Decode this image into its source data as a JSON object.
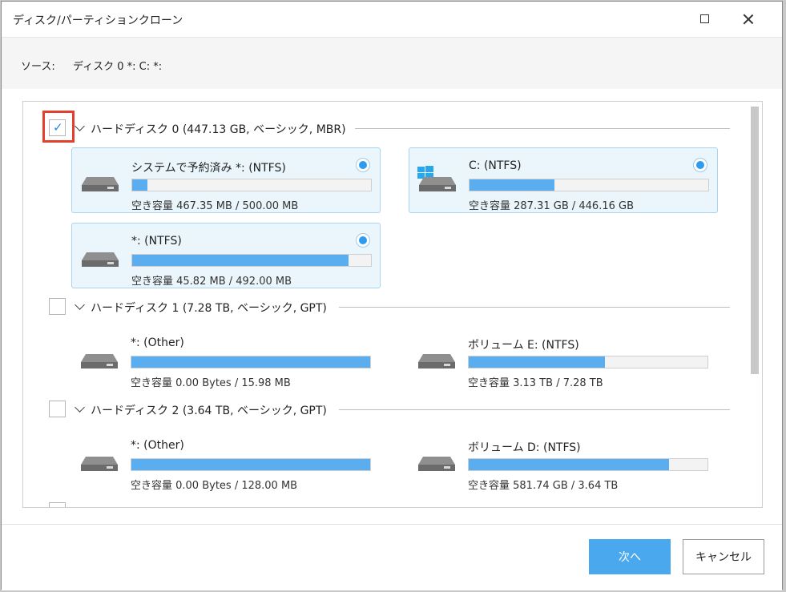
{
  "window": {
    "title": "ディスク/パーティションクローン"
  },
  "source": {
    "label": "ソース:",
    "value": "ディスク 0 *: C: *:"
  },
  "colors": {
    "accent": "#4aa8ee",
    "bar_fill": "#5aaef0",
    "selected_card_bg": "#eaf5fc",
    "highlight": "#e2402a"
  },
  "disks": [
    {
      "label": "ハードディスク 0 (447.13 GB, ベーシック, MBR)",
      "checked": true,
      "partitions": [
        {
          "name": "システムで予約済み *: (NTFS)",
          "free": "空き容量 467.35 MB / 500.00 MB",
          "used_fraction": 0.065,
          "selected": true,
          "icon": "drive-icon"
        },
        {
          "name": "C: (NTFS)",
          "free": "空き容量 287.31 GB / 446.16 GB",
          "used_fraction": 0.356,
          "selected": true,
          "icon": "windows-drive-icon"
        },
        {
          "name": "*: (NTFS)",
          "free": "空き容量 45.82 MB / 492.00 MB",
          "used_fraction": 0.907,
          "selected": true,
          "icon": "drive-icon"
        }
      ]
    },
    {
      "label": "ハードディスク 1 (7.28 TB, ベーシック, GPT)",
      "checked": false,
      "partitions": [
        {
          "name": "*: (Other)",
          "free": "空き容量 0.00 Bytes / 15.98 MB",
          "used_fraction": 1.0,
          "selected": false,
          "icon": "drive-icon"
        },
        {
          "name": "ボリューム E: (NTFS)",
          "free": "空き容量 3.13 TB / 7.28 TB",
          "used_fraction": 0.57,
          "selected": false,
          "icon": "drive-icon"
        }
      ]
    },
    {
      "label": "ハードディスク 2 (3.64 TB, ベーシック, GPT)",
      "checked": false,
      "partitions": [
        {
          "name": "*: (Other)",
          "free": "空き容量 0.00 Bytes / 128.00 MB",
          "used_fraction": 1.0,
          "selected": false,
          "icon": "drive-icon"
        },
        {
          "name": "ボリューム D: (NTFS)",
          "free": "空き容量 581.74 GB / 3.64 TB",
          "used_fraction": 0.84,
          "selected": false,
          "icon": "drive-icon"
        }
      ]
    }
  ],
  "footer": {
    "next_label": "次へ",
    "cancel_label": "キャンセル"
  }
}
